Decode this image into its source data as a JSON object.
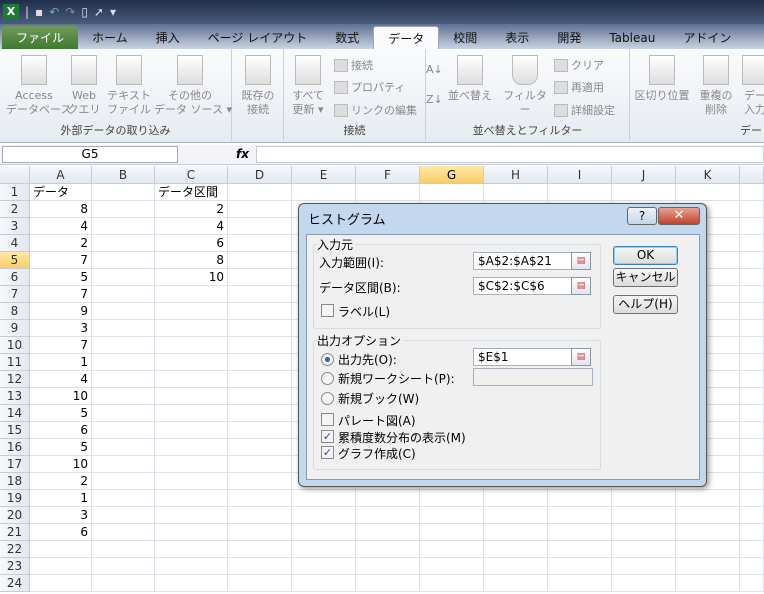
{
  "quick_access": {
    "sep": "|",
    "more": "▾"
  },
  "tabs": [
    "ファイル",
    "ホーム",
    "挿入",
    "ページ レイアウト",
    "数式",
    "データ",
    "校閲",
    "表示",
    "開発",
    "Tableau",
    "アドイン"
  ],
  "active_tab": "データ",
  "ribbon": {
    "external": {
      "label": "外部データの取り込み",
      "access": "Access\nデータベース",
      "web": "Web\nクエリ",
      "text": "テキスト\nファイル",
      "other": "その他の\nデータ ソース ▾",
      "existing": "既存の\n接続"
    },
    "connections": {
      "label": "接続",
      "refresh": "すべて\n更新 ▾",
      "conn": "接続",
      "props": "プロパティ",
      "links": "リンクの編集"
    },
    "sort": {
      "label": "並べ替えとフィルター",
      "sort": "並べ替え",
      "filter": "フィルター",
      "clear": "クリア",
      "reapply": "再適用",
      "advanced": "詳細設定"
    },
    "tools": {
      "split": "区切り位置",
      "dup": "重複の\n削除",
      "valid": "デー\n入力",
      "label": "デー"
    }
  },
  "formula_bar": {
    "name_box": "G5",
    "fx": "fx",
    "value": ""
  },
  "columns": [
    "A",
    "B",
    "C",
    "D",
    "E",
    "F",
    "G",
    "H",
    "I",
    "J",
    "K"
  ],
  "selected_column": "G",
  "selected_row": 5,
  "rows": [
    1,
    2,
    3,
    4,
    5,
    6,
    7,
    8,
    9,
    10,
    11,
    12,
    13,
    14,
    15,
    16,
    17,
    18,
    19,
    20,
    21,
    22,
    23,
    24
  ],
  "colA": {
    "header": "データ",
    "values": [
      8,
      4,
      2,
      7,
      5,
      7,
      9,
      3,
      7,
      1,
      4,
      10,
      5,
      6,
      5,
      10,
      2,
      1,
      3,
      6
    ]
  },
  "colC": {
    "header": "データ区間",
    "values": [
      2,
      4,
      6,
      8,
      10
    ]
  },
  "dialog": {
    "title": "ヒストグラム",
    "help_icon": "?",
    "close_icon": "✕",
    "input_group": "入力元",
    "input_range_label": "入力範囲(I):",
    "input_range": "$A$2:$A$21",
    "bin_range_label": "データ区間(B):",
    "bin_range": "$C$2:$C$6",
    "labels_label": "ラベル(L)",
    "labels_checked": false,
    "output_group": "出力オプション",
    "output_range_label": "出力先(O):",
    "output_range": "$E$1",
    "new_sheet_label": "新規ワークシート(P):",
    "new_sheet_value": "",
    "new_book_label": "新規ブック(W)",
    "selected_output": "出力先",
    "pareto_label": "パレート図(A)",
    "pareto_checked": false,
    "cumulative_label": "累積度数分布の表示(M)",
    "cumulative_checked": true,
    "chart_label": "グラフ作成(C)",
    "chart_checked": true,
    "ok": "OK",
    "cancel": "キャンセル",
    "help": "ヘルプ(H)",
    "ref_icon": "collapse-dialog-icon"
  }
}
